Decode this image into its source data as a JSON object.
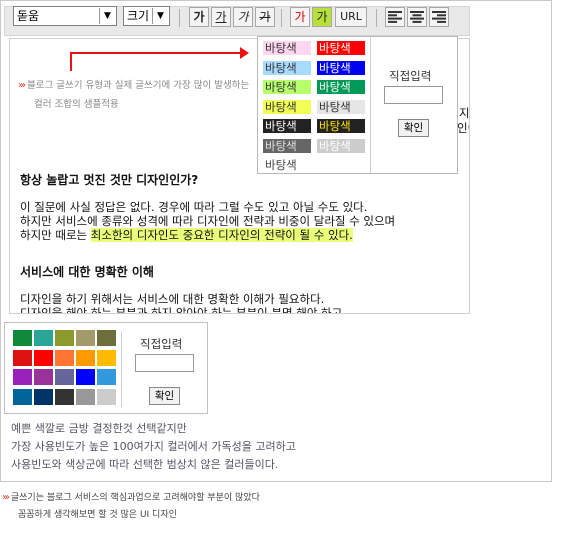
{
  "toolbar": {
    "font_select": "돋움",
    "size_select": "크기",
    "text_buttons": [
      "가",
      "가",
      "가",
      "가"
    ],
    "color_buttons": [
      "가",
      "가"
    ],
    "url_label": "URL",
    "align_icons": [
      "align-left-icon",
      "align-center-icon",
      "align-right-icon"
    ]
  },
  "bg_popup": {
    "swatch_label": "바탕색",
    "direct_input_label": "직접입력",
    "confirm_label": "확인",
    "swatches": [
      {
        "bg": "#ffd6f0",
        "fg": "#333333"
      },
      {
        "bg": "#ff0000",
        "fg": "#ffffff"
      },
      {
        "bg": "#a8dcff",
        "fg": "#333333"
      },
      {
        "bg": "#0000ee",
        "fg": "#ffffff"
      },
      {
        "bg": "#b8ff6e",
        "fg": "#333333"
      },
      {
        "bg": "#009955",
        "fg": "#ffffff"
      },
      {
        "bg": "#f2ff55",
        "fg": "#333333"
      },
      {
        "bg": "#e6e6e6",
        "fg": "#333333"
      },
      {
        "bg": "#222222",
        "fg": "#ffffff"
      },
      {
        "bg": "#222222",
        "fg": "#ffe400"
      },
      {
        "bg": "#666666",
        "fg": "#e0e0e0"
      },
      {
        "bg": "#cccccc",
        "fg": "#ffffff"
      },
      {
        "bg": "#ffffff",
        "fg": "#444444"
      }
    ]
  },
  "annotation": {
    "line1": "블로그 글쓰기 유형과 실제 글쓰기에 가장 많이 발생하는",
    "line2": "컬러 조합의 샘플적용"
  },
  "editor": {
    "cut_fragment_1": "지",
    "cut_fragment_2": "인이",
    "heading1": "항상 놀랍고 멋진 것만 디자인인가?",
    "para1_line1": "이 질문에 사실 정답은 없다. 경우에 따라 그럴 수도 있고 아닐 수도 있다.",
    "para1_line2": "하지만 서비스에 종류와 성격에 따라 디자인에 전략과 비중이 달라질 수 있으며",
    "para1_line3_prefix": "하지만 때로는 ",
    "para1_line3_highlight": "최소한의 디자인도 중요한 디자인의 전략이 될 수 있다.",
    "heading2": "서비스에 대한 명확한 이해",
    "para2_line1": "디자인을 하기 위해서는 서비스에 대한 명확한 이해가 필요하다.",
    "para2_line2": "디자인을 해야 하는 부분과 하지 않아야 하는 부분이 분명 해야 하고"
  },
  "palette": {
    "colors": [
      "#0f8a3c",
      "#2aa597",
      "#8c9a2c",
      "#a29a6a",
      "#6c6e3c",
      "#dd1111",
      "#ff0000",
      "#ff7733",
      "#ff9900",
      "#ffbb00",
      "#9922bb",
      "#993399",
      "#666699",
      "#0000ff",
      "#3399dd",
      "#006699",
      "#003366",
      "#333333",
      "#999999",
      "#cccccc"
    ],
    "direct_input_label": "직접입력",
    "confirm_label": "확인"
  },
  "notes": {
    "line1": "예쁜 색깔로 금방 결정한것 선택같지만",
    "line2": "가장 사용빈도가 높은 100여가지 컬러에서 가독성을 고려하고",
    "line3": "사용빈도와 색상군에 따라 선택한 범상치 않은 컬러들이다."
  },
  "footer": {
    "line1": "글쓰기는 블로그 서비스의 핵심과업으로 고려해야할 부분이 많았다",
    "line2": "꼼꼼하게 생각해보면 할 것 많은 UI 디자인"
  }
}
